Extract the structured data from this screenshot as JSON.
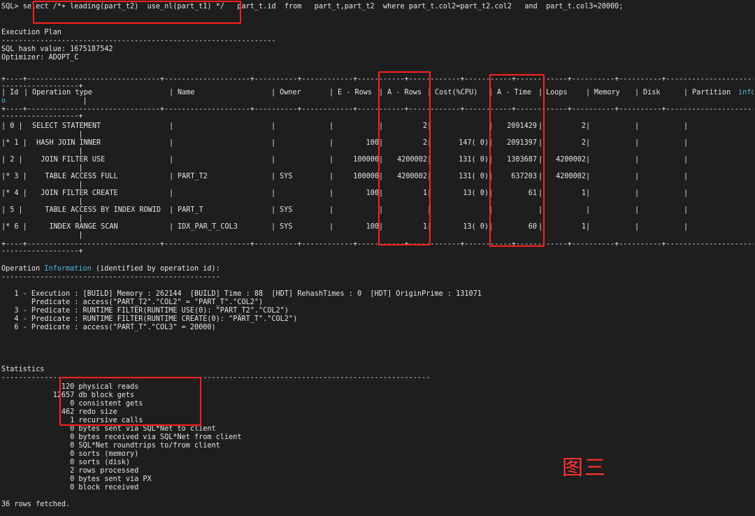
{
  "sql": {
    "prompt": "SQL>",
    "select_kw": "select",
    "hint": "/*+ leading(part_t2)  use_nl(part_t1) */",
    "rest": "part_t.id  from   part_t,part_t2  where part_t.col2=part_t2.col2   and  part_t.col3=20000;"
  },
  "plan": {
    "title": "Execution Plan",
    "rule1": "----------------------------------------------------------------",
    "hash_line": "SQL hash value: 1675187542",
    "optimizer_line": "Optimizer: ADOPT_C"
  },
  "table": {
    "headers": {
      "id": "Id",
      "operation": "Operation type",
      "name": "Name",
      "owner": "Owner",
      "e_rows": "E - Rows",
      "a_rows": "A - Rows",
      "cost": "Cost(%CPU)",
      "a_time": "A - Time",
      "loops": "Loops",
      "memory": "Memory",
      "disk": "Disk",
      "partition": "Partition",
      "partition_info": "info"
    },
    "rows": [
      {
        "id": "| 0 |",
        "op": "SELECT STATEMENT",
        "name": "",
        "owner": "",
        "e_rows": "",
        "a_rows": "2",
        "cost": "",
        "a_time": "2091429",
        "loops": "2",
        "memory": "",
        "disk": ""
      },
      {
        "id": "|* 1 |",
        "op": " HASH JOIN INNER",
        "name": "",
        "owner": "",
        "e_rows": "100",
        "a_rows": "2",
        "cost": "147( 0)",
        "a_time": "2091397",
        "loops": "2",
        "memory": "",
        "disk": ""
      },
      {
        "id": "| 2 |",
        "op": "  JOIN FILTER USE",
        "name": "",
        "owner": "",
        "e_rows": "100000",
        "a_rows": "4200002",
        "cost": "131( 0)",
        "a_time": "1303687",
        "loops": "4200002",
        "memory": "",
        "disk": ""
      },
      {
        "id": "|* 3 |",
        "op": "   TABLE ACCESS FULL",
        "name": "PART_T2",
        "owner": "SYS",
        "e_rows": "100000",
        "a_rows": "4200002",
        "cost": "131( 0)",
        "a_time": "637203",
        "loops": "4200002",
        "memory": "",
        "disk": ""
      },
      {
        "id": "|* 4 |",
        "op": "  JOIN FILTER CREATE",
        "name": "",
        "owner": "",
        "e_rows": "100",
        "a_rows": "1",
        "cost": "13( 0)",
        "a_time": "61",
        "loops": "1",
        "memory": "",
        "disk": ""
      },
      {
        "id": "| 5 |",
        "op": "   TABLE ACCESS BY INDEX ROWID",
        "name": "PART_T",
        "owner": "SYS",
        "e_rows": "",
        "a_rows": "",
        "cost": "",
        "a_time": "",
        "loops": "",
        "memory": "",
        "disk": ""
      },
      {
        "id": "|* 6 |",
        "op": "    INDEX RANGE SCAN",
        "name": "IDX_PAR_T_COL3",
        "owner": "SYS",
        "e_rows": "100",
        "a_rows": "1",
        "cost": "13( 0)",
        "a_time": "60",
        "loops": "1",
        "memory": "",
        "disk": ""
      }
    ]
  },
  "opinfo": {
    "prefix": "Operation ",
    "highlight": "Information",
    "suffix": " (identified by operation id):",
    "rule": "---------------------------------------------------",
    "lines": [
      "   1 - Execution : [BUILD] Memory : 262144  [BUILD] Time : 88  [HDT] RehashTimes : 0  [HDT] OriginPrime : 131071",
      "       Predicate : access(\"PART_T2\".\"COL2\" = \"PART_T\".\"COL2\")",
      "   3 - Predicate : RUNTIME FILTER(RUNTIME USE(0): \"PART_T2\".\"COL2\")",
      "   4 - Predicate : RUNTIME FILTER(RUNTIME CREATE(0): \"PART_T\".\"COL2\")",
      "   6 - Predicate : access(\"PART_T\".\"COL3\" = 20000)"
    ]
  },
  "stats": {
    "title": "Statistics",
    "rule": "----------------------------------------------------------------------------------------------------",
    "lines": [
      "              120 physical reads",
      "            12657 db block gets",
      "                0 consistent gets",
      "              462 redo size",
      "                1 recursive calls",
      "                0 bytes sent via SQL*Net to client",
      "                0 bytes received via SQL*Net from client",
      "                0 SQL*Net roundtrips to/from client",
      "                0 sorts (memory)",
      "                0 sorts (disk)",
      "                2 rows processed",
      "                0 bytes sent via PX",
      "                0 block received"
    ]
  },
  "footer": "36 rows fetched.",
  "annotation": "图三",
  "colors": {
    "background": "#1e1e1e",
    "text": "#e6e6e6",
    "highlight_box": "#ff2020",
    "info_word": "#4db8e8"
  }
}
